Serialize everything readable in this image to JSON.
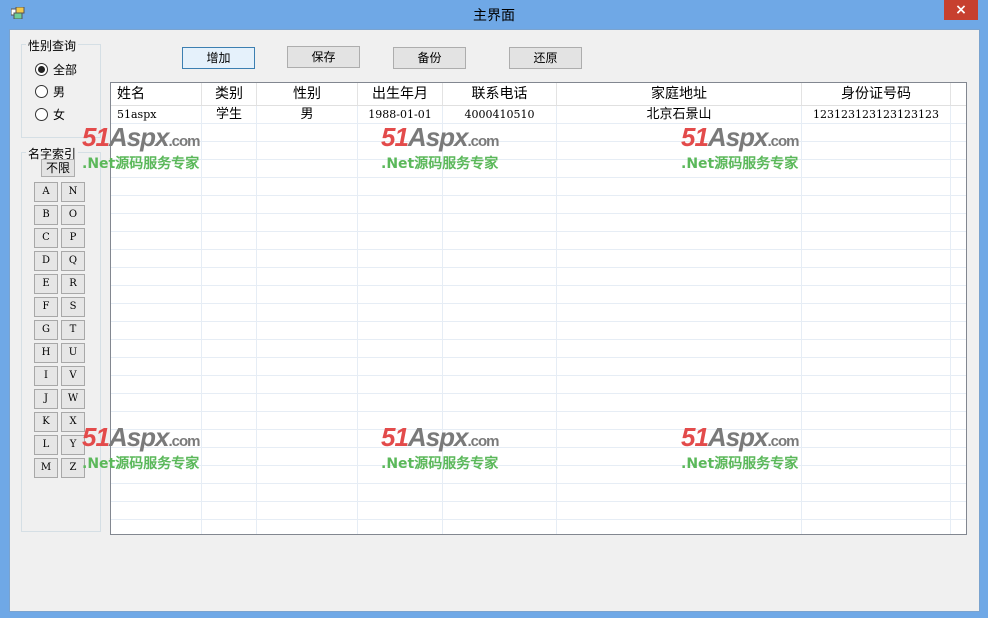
{
  "window": {
    "title": "主界面",
    "close_label": "×"
  },
  "gender_query": {
    "label": "性别查询",
    "options": [
      {
        "label": "全部",
        "checked": true
      },
      {
        "label": "男",
        "checked": false
      },
      {
        "label": "女",
        "checked": false
      }
    ]
  },
  "name_index": {
    "label": "名字索引",
    "unlimited_label": "不限",
    "left_letters": [
      "A",
      "B",
      "C",
      "D",
      "E",
      "F",
      "G",
      "H",
      "I",
      "J",
      "K",
      "L",
      "M"
    ],
    "right_letters": [
      "N",
      "O",
      "P",
      "Q",
      "R",
      "S",
      "T",
      "U",
      "V",
      "W",
      "X",
      "Y",
      "Z"
    ]
  },
  "toolbar": {
    "add_label": "增加",
    "save_label": "保存",
    "backup_label": "备份",
    "restore_label": "还原"
  },
  "grid": {
    "columns": [
      "姓名",
      "类别",
      "性别",
      "出生年月",
      "联系电话",
      "家庭地址",
      "身份证号码"
    ],
    "rows": [
      [
        "51aspx",
        "学生",
        "男",
        "1988-01-01",
        "4000410510",
        "北京石景山",
        "123123123123123123"
      ]
    ]
  },
  "watermark": {
    "logo_num": "51",
    "logo_aspx": "Aspx",
    "logo_com": ".com",
    "sub": ".Net源码服务专家"
  }
}
